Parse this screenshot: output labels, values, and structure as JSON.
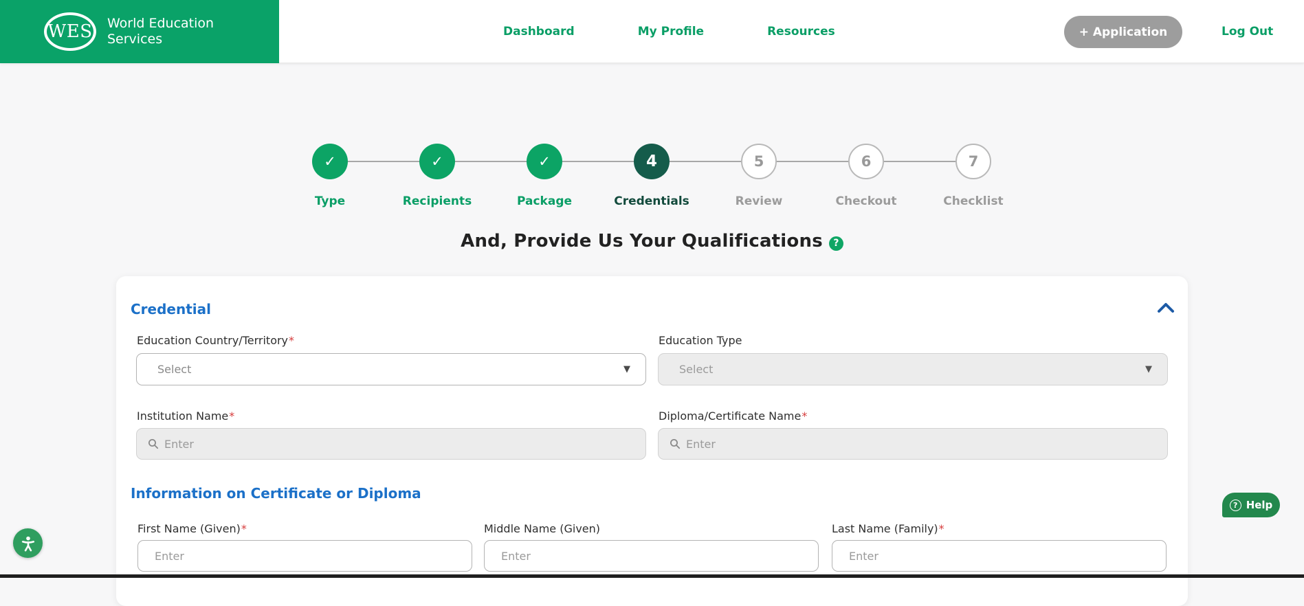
{
  "header": {
    "logo": {
      "mark": "WES",
      "name_line1": "World Education",
      "name_line2": "Services"
    },
    "nav": [
      {
        "label": "Dashboard"
      },
      {
        "label": "My Profile"
      },
      {
        "label": "Resources"
      }
    ],
    "application_button": "+ Application",
    "logout": "Log Out"
  },
  "stepper": {
    "steps": [
      {
        "label": "Type",
        "state": "complete"
      },
      {
        "label": "Recipients",
        "state": "complete"
      },
      {
        "label": "Package",
        "state": "complete"
      },
      {
        "label": "Credentials",
        "state": "active",
        "number": "4"
      },
      {
        "label": "Review",
        "state": "upcoming",
        "number": "5"
      },
      {
        "label": "Checkout",
        "state": "upcoming",
        "number": "6"
      },
      {
        "label": "Checklist",
        "state": "upcoming",
        "number": "7"
      }
    ]
  },
  "page": {
    "title": "And, Provide Us Your Qualifications"
  },
  "credential_section": {
    "heading": "Credential",
    "fields": {
      "education_country": {
        "label": "Education Country/Territory",
        "required": true,
        "placeholder": "Select"
      },
      "education_type": {
        "label": "Education Type",
        "required": false,
        "placeholder": "Select",
        "disabled": true
      },
      "institution_name": {
        "label": "Institution Name",
        "required": true,
        "placeholder": "Enter",
        "disabled": true
      },
      "diploma_name": {
        "label": "Diploma/Certificate Name",
        "required": true,
        "placeholder": "Enter",
        "disabled": true
      }
    }
  },
  "info_section": {
    "heading": "Information on Certificate or Diploma",
    "fields": {
      "first_name": {
        "label": "First Name (Given)",
        "required": true,
        "placeholder": "Enter"
      },
      "middle_name": {
        "label": "Middle Name (Given)",
        "required": false,
        "placeholder": "Enter"
      },
      "last_name": {
        "label": "Last Name (Family)",
        "required": true,
        "placeholder": "Enter"
      }
    }
  },
  "floating": {
    "help_label": "Help"
  },
  "icons": {
    "check": "✓",
    "dropdown_arrow": "▼",
    "question": "?",
    "required_mark": "*"
  },
  "colors": {
    "brand_green": "#0aa268",
    "link_green": "#0a9e66",
    "active_step": "#155c4b",
    "heading_blue": "#1b70c8",
    "button_gray": "#9d9d9d",
    "help_green": "#23884d",
    "required_red": "#d63b3b",
    "disabled_bg": "#ececec"
  }
}
